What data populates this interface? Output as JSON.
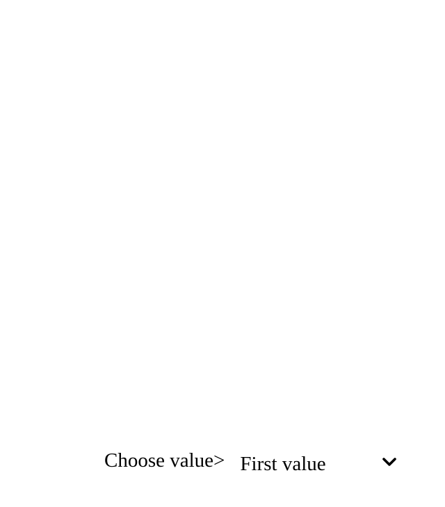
{
  "form": {
    "label": "Choose value>",
    "select": {
      "selected_value": "First value",
      "icon": "chevron-down-icon"
    }
  },
  "colors": {
    "background": "#ffffff",
    "text": "#000000"
  }
}
